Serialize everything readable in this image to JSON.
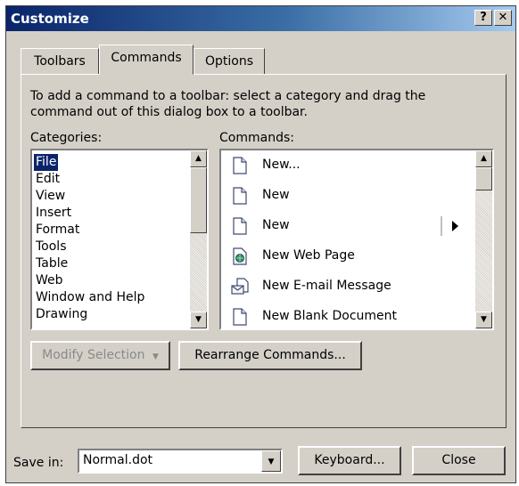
{
  "window": {
    "title": "Customize",
    "help_glyph": "?",
    "close_glyph": "✕"
  },
  "tabs": [
    {
      "label": "Toolbars"
    },
    {
      "label": "Commands",
      "active": true
    },
    {
      "label": "Options"
    }
  ],
  "instructions": "To add a command to a toolbar: select a category and drag the command out of this dialog box to a toolbar.",
  "categories": {
    "label": "Categories:",
    "items": [
      "File",
      "Edit",
      "View",
      "Insert",
      "Format",
      "Tools",
      "Table",
      "Web",
      "Window and Help",
      "Drawing"
    ],
    "selected": "File"
  },
  "commands": {
    "label": "Commands:",
    "items": [
      {
        "label": "New...",
        "icon": "blank-document-icon"
      },
      {
        "label": "New",
        "icon": "blank-document-icon"
      },
      {
        "label": "New",
        "icon": "blank-document-icon",
        "has_submenu": true
      },
      {
        "label": "New Web Page",
        "icon": "web-page-icon"
      },
      {
        "label": "New E-mail Message",
        "icon": "email-message-icon"
      },
      {
        "label": "New Blank Document",
        "icon": "blank-document-icon"
      }
    ]
  },
  "buttons": {
    "modify_selection": "Modify Selection",
    "rearrange": "Rearrange Commands...",
    "keyboard": "Keyboard...",
    "close": "Close"
  },
  "save_in": {
    "label": "Save in:",
    "value": "Normal.dot"
  },
  "colors": {
    "selection": "#0a246a",
    "titlebar_start": "#0a246a",
    "face": "#d4d0c8"
  }
}
